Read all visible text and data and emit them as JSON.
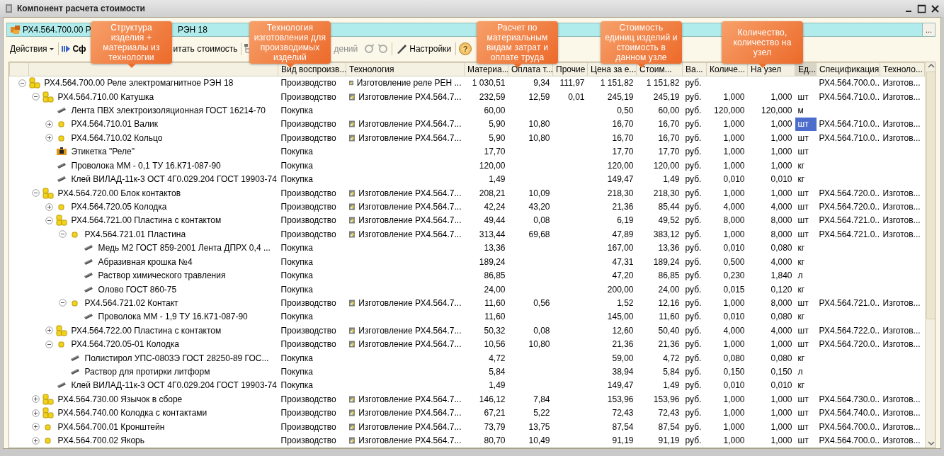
{
  "window": {
    "title": "Компонент расчета стоимости"
  },
  "object_field": {
    "visible_start": "РХ4.564.700.00 Р",
    "visible_end": "РЭН 18",
    "button": "..."
  },
  "toolbar": {
    "actions": "Действия",
    "calc_start": "Сф",
    "calc_end": "итать стоимость",
    "greyed_text": "дений",
    "settings": "Настройки",
    "help": "?"
  },
  "callouts": [
    {
      "text": "Структура изделия + материалы из технологии"
    },
    {
      "text": "Технология изготовления для производимых изделий"
    },
    {
      "text": "Расчет по материальным видам затрат и оплате труда"
    },
    {
      "text": "Стоимость единиц изделий и стоимость в данном узле"
    },
    {
      "text": "Количество, количество на узел"
    }
  ],
  "columns": [
    {
      "label": "Вид воспроизв...",
      "selected": false
    },
    {
      "label": "Технология",
      "selected": false
    },
    {
      "label": "Материа...",
      "selected": false
    },
    {
      "label": "Оплата т...",
      "selected": false
    },
    {
      "label": "Прочие",
      "selected": false
    },
    {
      "label": "Цена за е...",
      "selected": false
    },
    {
      "label": "Стоим...",
      "selected": false
    },
    {
      "label": "Ва...",
      "selected": false
    },
    {
      "label": "Количе...",
      "selected": false
    },
    {
      "label": "На узел",
      "selected": false
    },
    {
      "label": "Ед...",
      "selected": true
    },
    {
      "label": "Спецификация",
      "selected": false
    },
    {
      "label": "Техноло...",
      "selected": false
    }
  ],
  "rows": [
    {
      "name": "РХ4.564.700.00 Реле электромагнитное РЭН 18",
      "kind": "assembly",
      "expanded": true,
      "selected": false,
      "reproduction": "Производство",
      "technology": "Изготовление реле РЕН ...",
      "materials": "1 030,51",
      "labor": "9,34",
      "other": "111,97",
      "unit_price": "1 151,82",
      "cost": "1 151,82",
      "currency": "руб.",
      "specification": "РХ4.564.700.0...",
      "technology_short": "Изготов...",
      "children": [
        {
          "name": "РХ4.564.710.00 Катушка",
          "kind": "assembly",
          "expanded": true,
          "selected": false,
          "reproduction": "Производство",
          "technology": "Изготовление РХ4.564.7...",
          "materials": "232,59",
          "labor": "12,59",
          "other": "0,01",
          "unit_price": "245,19",
          "cost": "245,19",
          "currency": "руб.",
          "quantity": "1,000",
          "quantity_per_node": "1,000",
          "unit": "шт",
          "specification": "РХ4.564.710.0...",
          "technology_short": "Изготов...",
          "children": [
            {
              "name": "Лента  ПВХ электроизоляционная  ГОСТ 16214-70",
              "kind": "material",
              "selected": false,
              "reproduction": "Покупка",
              "materials": "60,00",
              "unit_price": "0,50",
              "cost": "60,00",
              "currency": "руб.",
              "quantity": "120,000",
              "quantity_per_node": "120,000",
              "unit": "м"
            },
            {
              "name": "РХ4.564.710.01 Валик",
              "kind": "part",
              "expanded": false,
              "selected": true,
              "reproduction": "Производство",
              "technology": "Изготовление РХ4.564.7...",
              "materials": "5,90",
              "labor": "10,80",
              "unit_price": "16,70",
              "cost": "16,70",
              "currency": "руб.",
              "quantity": "1,000",
              "quantity_per_node": "1,000",
              "unit": "шт",
              "specification": "РХ4.564.710.0...",
              "technology_short": "Изготов..."
            },
            {
              "name": "РХ4.564.710.02 Кольцо",
              "kind": "part",
              "expanded": false,
              "selected": false,
              "reproduction": "Производство",
              "technology": "Изготовление РХ4.564.7...",
              "materials": "5,90",
              "labor": "10,80",
              "unit_price": "16,70",
              "cost": "16,70",
              "currency": "руб.",
              "quantity": "1,000",
              "quantity_per_node": "1,000",
              "unit": "шт",
              "specification": "РХ4.564.710.0...",
              "technology_short": "Изготов..."
            },
            {
              "name": "Этикетка \"Реле\"",
              "kind": "label",
              "selected": false,
              "reproduction": "Покупка",
              "materials": "17,70",
              "unit_price": "17,70",
              "cost": "17,70",
              "currency": "руб.",
              "quantity": "1,000",
              "quantity_per_node": "1,000",
              "unit": "шт"
            },
            {
              "name": "Проволока ММ - 0,1 ТУ 16.К71-087-90",
              "kind": "material",
              "selected": false,
              "reproduction": "Покупка",
              "materials": "120,00",
              "unit_price": "120,00",
              "cost": "120,00",
              "currency": "руб.",
              "quantity": "1,000",
              "quantity_per_node": "1,000",
              "unit": "кг"
            },
            {
              "name": "Клей ВИЛАД-11к-3 ОСТ 4Г0.029.204 ГОСТ 19903-74",
              "kind": "material",
              "selected": false,
              "reproduction": "Покупка",
              "materials": "1,49",
              "unit_price": "149,47",
              "cost": "1,49",
              "currency": "руб.",
              "quantity": "0,010",
              "quantity_per_node": "0,010",
              "unit": "кг"
            }
          ]
        },
        {
          "name": "РХ4.564.720.00 Блок контактов",
          "kind": "assembly",
          "expanded": true,
          "selected": false,
          "reproduction": "Производство",
          "technology": "Изготовление РХ4.564.7...",
          "materials": "208,21",
          "labor": "10,09",
          "unit_price": "218,30",
          "cost": "218,30",
          "currency": "руб.",
          "quantity": "1,000",
          "quantity_per_node": "1,000",
          "unit": "шт",
          "specification": "РХ4.564.720.0...",
          "technology_short": "Изготов...",
          "children": [
            {
              "name": "РХ4.564.720.05 Колодка",
              "kind": "part",
              "expanded": false,
              "selected": false,
              "reproduction": "Производство",
              "technology": "Изготовление РХ4.564.7...",
              "materials": "42,24",
              "labor": "43,20",
              "unit_price": "21,36",
              "cost": "85,44",
              "currency": "руб.",
              "quantity": "4,000",
              "quantity_per_node": "4,000",
              "unit": "шт",
              "specification": "РХ4.564.720.0...",
              "technology_short": "Изготов..."
            },
            {
              "name": "РХ4.564.721.00 Пластина с контактом",
              "kind": "assembly",
              "expanded": true,
              "selected": false,
              "reproduction": "Производство",
              "technology": "Изготовление РХ4.564.7...",
              "materials": "49,44",
              "labor": "0,08",
              "unit_price": "6,19",
              "cost": "49,52",
              "currency": "руб.",
              "quantity": "8,000",
              "quantity_per_node": "8,000",
              "unit": "шт",
              "specification": "РХ4.564.721.0...",
              "technology_short": "Изготов...",
              "children": [
                {
                  "name": "РХ4.564.721.01 Пластина",
                  "kind": "part",
                  "expanded": true,
                  "selected": false,
                  "reproduction": "Производство",
                  "technology": "Изготовление РХ4.564.7...",
                  "materials": "313,44",
                  "labor": "69,68",
                  "unit_price": "47,89",
                  "cost": "383,12",
                  "currency": "руб.",
                  "quantity": "1,000",
                  "quantity_per_node": "8,000",
                  "unit": "шт",
                  "specification": "РХ4.564.721.0...",
                  "technology_short": "Изготов...",
                  "children": [
                    {
                      "name": "Медь М2 ГОСТ 859-2001 Лента ДПРХ  0,4 ...",
                      "kind": "material",
                      "selected": false,
                      "reproduction": "Покупка",
                      "materials": "13,36",
                      "unit_price": "167,00",
                      "cost": "13,36",
                      "currency": "руб.",
                      "quantity": "0,010",
                      "quantity_per_node": "0,080",
                      "unit": "кг"
                    },
                    {
                      "name": "Абразивная крошка №4",
                      "kind": "material",
                      "selected": false,
                      "reproduction": "Покупка",
                      "materials": "189,24",
                      "unit_price": "47,31",
                      "cost": "189,24",
                      "currency": "руб.",
                      "quantity": "0,500",
                      "quantity_per_node": "4,000",
                      "unit": "кг"
                    },
                    {
                      "name": "Раствор химического травления",
                      "kind": "material",
                      "selected": false,
                      "reproduction": "Покупка",
                      "materials": "86,85",
                      "unit_price": "47,20",
                      "cost": "86,85",
                      "currency": "руб.",
                      "quantity": "0,230",
                      "quantity_per_node": "1,840",
                      "unit": "л"
                    },
                    {
                      "name": "Олово ГОСТ 860-75",
                      "kind": "material",
                      "selected": false,
                      "reproduction": "Покупка",
                      "materials": "24,00",
                      "unit_price": "200,00",
                      "cost": "24,00",
                      "currency": "руб.",
                      "quantity": "0,015",
                      "quantity_per_node": "0,120",
                      "unit": "кг"
                    }
                  ]
                },
                {
                  "name": "РХ4.564.721.02 Контакт",
                  "kind": "part",
                  "expanded": true,
                  "selected": false,
                  "reproduction": "Производство",
                  "technology": "Изготовление РХ4.564.7...",
                  "materials": "11,60",
                  "labor": "0,56",
                  "unit_price": "1,52",
                  "cost": "12,16",
                  "currency": "руб.",
                  "quantity": "1,000",
                  "quantity_per_node": "8,000",
                  "unit": "шт",
                  "specification": "РХ4.564.721.0...",
                  "technology_short": "Изготов...",
                  "children": [
                    {
                      "name": "Проволока ММ - 1,9 ТУ 16.К71-087-90",
                      "kind": "material",
                      "selected": false,
                      "reproduction": "Покупка",
                      "materials": "11,60",
                      "unit_price": "145,00",
                      "cost": "11,60",
                      "currency": "руб.",
                      "quantity": "0,010",
                      "quantity_per_node": "0,080",
                      "unit": "кг"
                    }
                  ]
                }
              ]
            },
            {
              "name": "РХ4.564.722.00 Пластина с контактом",
              "kind": "assembly",
              "expanded": false,
              "selected": false,
              "reproduction": "Производство",
              "technology": "Изготовление РХ4.564.7...",
              "materials": "50,32",
              "labor": "0,08",
              "unit_price": "12,60",
              "cost": "50,40",
              "currency": "руб.",
              "quantity": "4,000",
              "quantity_per_node": "4,000",
              "unit": "шт",
              "specification": "РХ4.564.722.0...",
              "technology_short": "Изготов..."
            },
            {
              "name": "РХ4.564.720.05-01 Колодка",
              "kind": "part",
              "expanded": true,
              "selected": false,
              "reproduction": "Производство",
              "technology": "Изготовление РХ4.564.7...",
              "materials": "10,56",
              "labor": "10,80",
              "unit_price": "21,36",
              "cost": "21,36",
              "currency": "руб.",
              "quantity": "1,000",
              "quantity_per_node": "1,000",
              "unit": "шт",
              "specification": "РХ4.564.720.0...",
              "technology_short": "Изготов...",
              "children": [
                {
                  "name": "Полистирол УПС-0803Э  ГОСТ 28250-89  ГОС...",
                  "kind": "material",
                  "selected": false,
                  "reproduction": "Покупка",
                  "materials": "4,72",
                  "unit_price": "59,00",
                  "cost": "4,72",
                  "currency": "руб.",
                  "quantity": "0,080",
                  "quantity_per_node": "0,080",
                  "unit": "кг"
                },
                {
                  "name": "Раствор для протирки литформ",
                  "kind": "material",
                  "selected": false,
                  "reproduction": "Покупка",
                  "materials": "5,84",
                  "unit_price": "38,94",
                  "cost": "5,84",
                  "currency": "руб.",
                  "quantity": "0,150",
                  "quantity_per_node": "0,150",
                  "unit": "л"
                }
              ]
            },
            {
              "name": "Клей ВИЛАД-11к-3 ОСТ 4Г0.029.204 ГОСТ 19903-74",
              "kind": "material",
              "selected": false,
              "reproduction": "Покупка",
              "materials": "1,49",
              "unit_price": "149,47",
              "cost": "1,49",
              "currency": "руб.",
              "quantity": "0,010",
              "quantity_per_node": "0,010",
              "unit": "кг"
            }
          ]
        },
        {
          "name": "РХ4.564.730.00 Язычок в сборе",
          "kind": "assembly",
          "expanded": false,
          "selected": false,
          "reproduction": "Производство",
          "technology": "Изготовление РХ4.564.7...",
          "materials": "146,12",
          "labor": "7,84",
          "unit_price": "153,96",
          "cost": "153,96",
          "currency": "руб.",
          "quantity": "1,000",
          "quantity_per_node": "1,000",
          "unit": "шт",
          "specification": "РХ4.564.730.0...",
          "technology_short": "Изготов..."
        },
        {
          "name": "РХ4.564.740.00 Колодка с контактами",
          "kind": "assembly",
          "expanded": false,
          "selected": false,
          "reproduction": "Производство",
          "technology": "Изготовление РХ4.564.7...",
          "materials": "67,21",
          "labor": "5,22",
          "unit_price": "72,43",
          "cost": "72,43",
          "currency": "руб.",
          "quantity": "1,000",
          "quantity_per_node": "1,000",
          "unit": "шт",
          "specification": "РХ4.564.740.0...",
          "technology_short": "Изготов..."
        },
        {
          "name": "РХ4.564.700.01 Кронштейн",
          "kind": "part",
          "expanded": false,
          "selected": false,
          "reproduction": "Производство",
          "technology": "Изготовление РХ4.564.7...",
          "materials": "73,79",
          "labor": "13,75",
          "unit_price": "87,54",
          "cost": "87,54",
          "currency": "руб.",
          "quantity": "1,000",
          "quantity_per_node": "1,000",
          "unit": "шт",
          "specification": "РХ4.564.700.0...",
          "technology_short": "Изготов..."
        },
        {
          "name": "РХ4.564.700.02 Якорь",
          "kind": "part",
          "expanded": false,
          "selected": false,
          "reproduction": "Производство",
          "technology": "Изготовление РХ4.564.7...",
          "materials": "80,70",
          "labor": "10,49",
          "unit_price": "91,19",
          "cost": "91,19",
          "currency": "руб.",
          "quantity": "1,000",
          "quantity_per_node": "1,000",
          "unit": "шт",
          "specification": "РХ4.564.700.0...",
          "technology_short": "Изготов..."
        }
      ]
    }
  ]
}
